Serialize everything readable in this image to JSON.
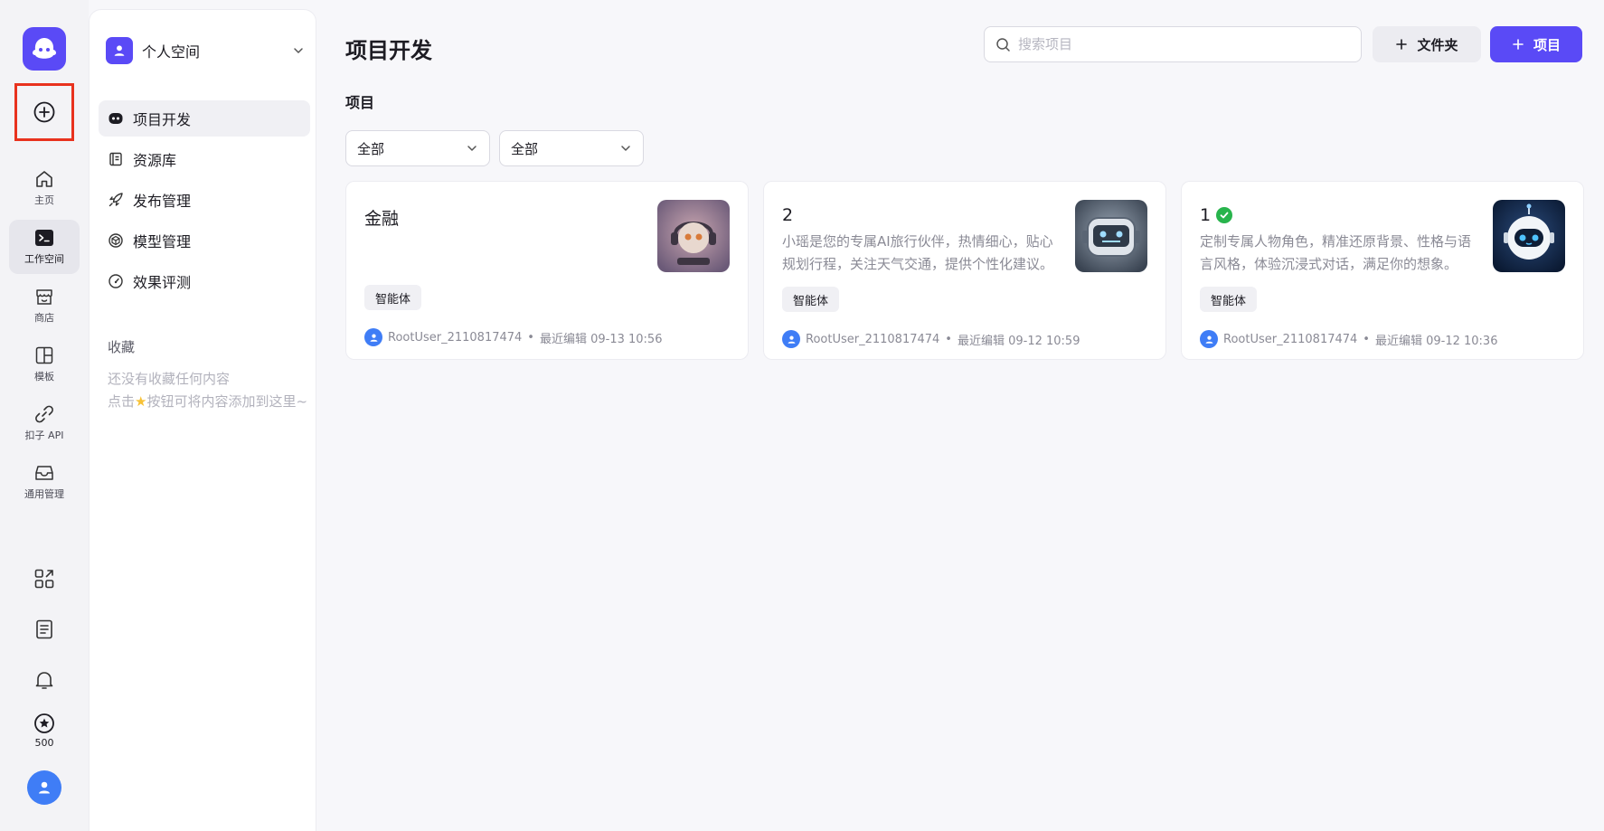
{
  "rail": {
    "nav": [
      {
        "label": "主页",
        "icon": "home-icon"
      },
      {
        "label": "工作空间",
        "icon": "terminal-icon"
      },
      {
        "label": "商店",
        "icon": "store-icon"
      },
      {
        "label": "模板",
        "icon": "template-icon"
      },
      {
        "label": "扣子 API",
        "icon": "api-link-icon"
      },
      {
        "label": "通用管理",
        "icon": "inbox-icon"
      }
    ],
    "credits": "500"
  },
  "sidebar": {
    "space_name": "个人空间",
    "menu": [
      {
        "label": "项目开发",
        "icon": "bot-icon"
      },
      {
        "label": "资源库",
        "icon": "library-icon"
      },
      {
        "label": "发布管理",
        "icon": "rocket-icon"
      },
      {
        "label": "模型管理",
        "icon": "model-cube-icon"
      },
      {
        "label": "效果评测",
        "icon": "gauge-icon"
      }
    ],
    "favorites_title": "收藏",
    "favorites_empty_line1": "还没有收藏任何内容",
    "favorites_empty_line2_pre": "点击",
    "favorites_empty_line2_post": "按钮可将内容添加到这里~"
  },
  "main": {
    "title": "项目开发",
    "search_placeholder": "搜索项目",
    "folder_btn": "文件夹",
    "project_btn": "项目",
    "section_label": "项目",
    "filter1": "全部",
    "filter2": "全部",
    "cards": [
      {
        "title": "金融",
        "desc": "",
        "tag": "智能体",
        "owner": "RootUser_2110817474",
        "edited": "最近编辑 09-13 10:56"
      },
      {
        "title": "2",
        "desc": "小瑶是您的专属AI旅行伙伴，热情细心，贴心规划行程，关注天气交通，提供个性化建议。",
        "tag": "智能体",
        "owner": "RootUser_2110817474",
        "edited": "最近编辑 09-12 10:59"
      },
      {
        "title": "1",
        "desc": "定制专属人物角色，精准还原背景、性格与语言风格，体验沉浸式对话，满足你的想象。",
        "tag": "智能体",
        "owner": "RootUser_2110817474",
        "edited": "最近编辑 09-12 10:36"
      }
    ]
  },
  "colors": {
    "brand": "#5a4af6",
    "highlight_border": "#e8321e",
    "published_check": "#28b44c",
    "avatar": "#3f7df6"
  }
}
